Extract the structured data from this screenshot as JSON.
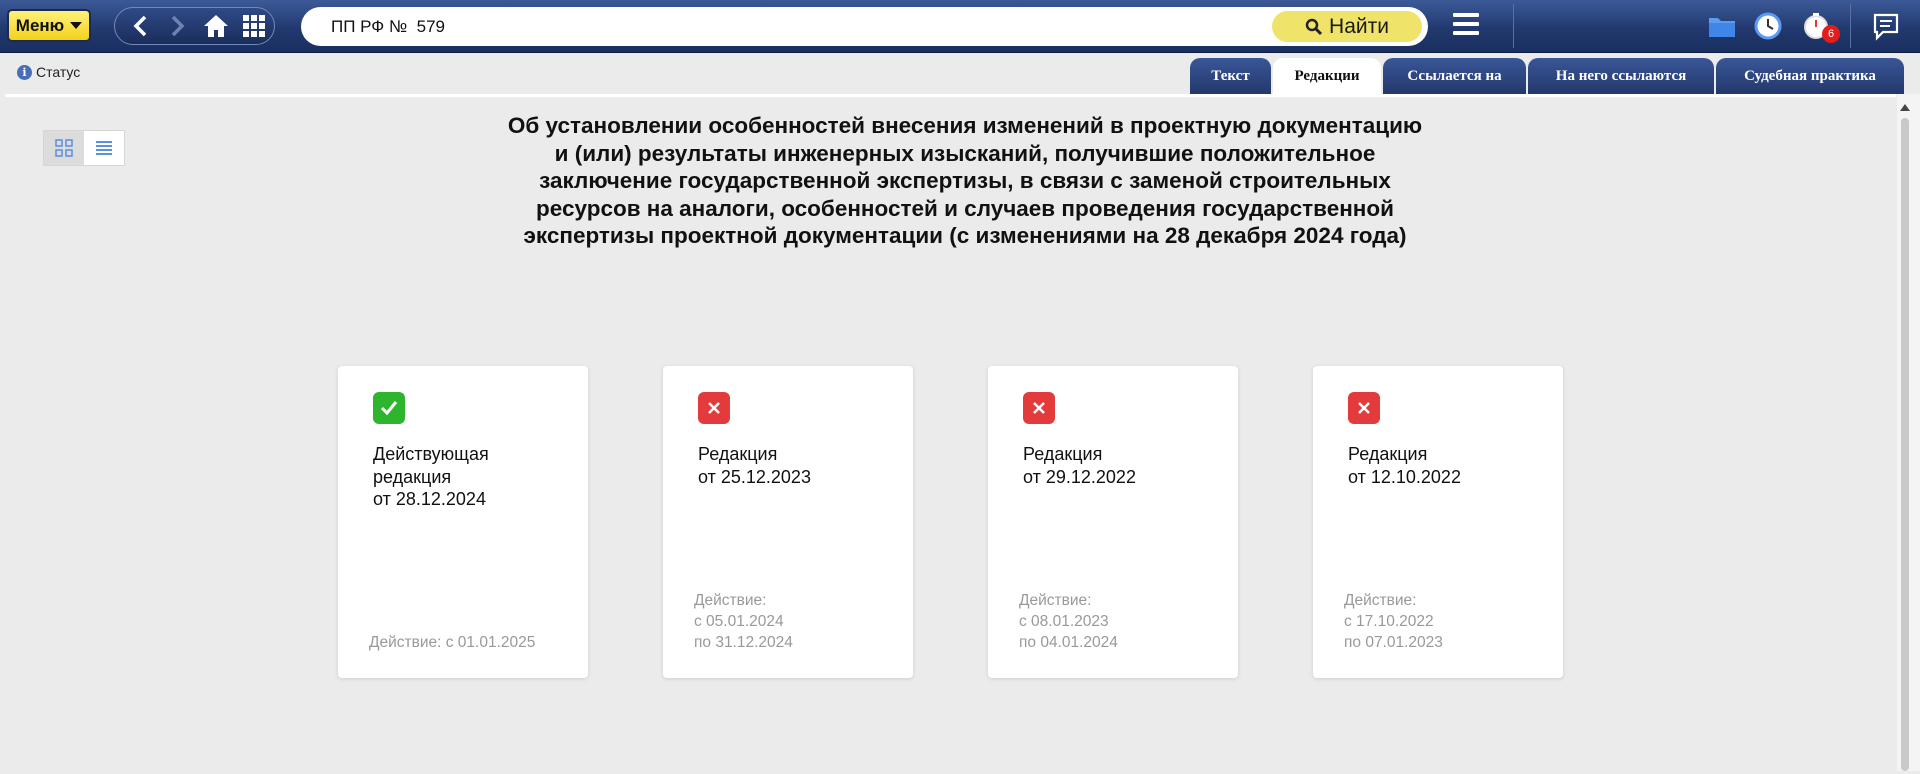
{
  "topbar": {
    "menu_label": "Меню",
    "search_value": "ПП РФ №  579",
    "find_label": "Найти",
    "notification_count": "6"
  },
  "status_label": "Статус",
  "tabs": [
    {
      "label": "Текст",
      "active": false
    },
    {
      "label": "Редакции",
      "active": true
    },
    {
      "label": "Ссылается на",
      "active": false
    },
    {
      "label": "На него ссылаются",
      "active": false
    },
    {
      "label": "Судебная практика",
      "active": false
    }
  ],
  "document": {
    "title_lines": [
      "Об установлении особенностей внесения изменений в проектную документацию",
      "и (или) результаты инженерных изысканий, получившие положительное",
      "заключение государственной экспертизы, в связи с заменой строительных",
      "ресурсов на аналоги, особенностей и случаев проведения государственной",
      "экспертизы проектной документации (с изменениями на 28 декабря 2024 года)"
    ]
  },
  "editions": [
    {
      "status": "current",
      "name_lines": [
        "Действующая",
        "редакция",
        "от 28.12.2024"
      ],
      "validity_lines": [
        "Действие: с 01.01.2025"
      ]
    },
    {
      "status": "inactive",
      "name_lines": [
        "Редакция",
        "от 25.12.2023"
      ],
      "validity_lines": [
        "Действие:",
        "с 05.01.2024",
        "по 31.12.2024"
      ]
    },
    {
      "status": "inactive",
      "name_lines": [
        "Редакция",
        "от 29.12.2022"
      ],
      "validity_lines": [
        "Действие:",
        "с 08.01.2023",
        "по 04.01.2024"
      ]
    },
    {
      "status": "inactive",
      "name_lines": [
        "Редакция",
        "от 12.10.2022"
      ],
      "validity_lines": [
        "Действие:",
        "с 17.10.2022",
        "по 07.01.2023"
      ]
    }
  ],
  "colors": {
    "topbar": "#22396f",
    "menu_button": "#f3d21b",
    "find_button": "#f0e36a",
    "current_icon": "#2db52d",
    "inactive_icon": "#e33b3b",
    "badge": "#e41c1c"
  },
  "icons": [
    "back-arrow-icon",
    "forward-arrow-icon",
    "home-icon",
    "apps-grid-icon",
    "search-icon",
    "hamburger-icon",
    "folder-icon",
    "clock-icon",
    "stopwatch-icon",
    "message-icon",
    "info-icon",
    "grid-view-icon",
    "list-view-icon",
    "check-icon",
    "cross-icon"
  ]
}
